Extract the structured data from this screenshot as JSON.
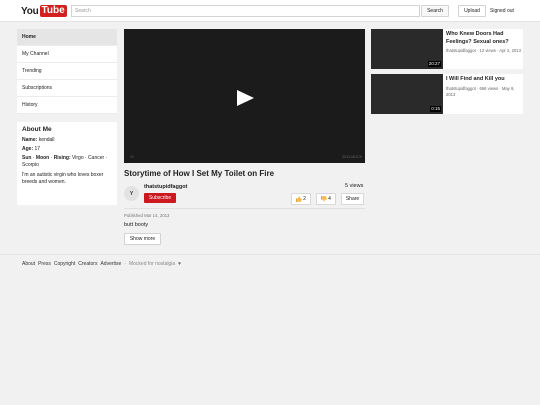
{
  "header": {
    "logo_you": "You",
    "logo_tube": "Tube",
    "search_placeholder": "Search",
    "search_button": "Search",
    "upload_button": "Upload",
    "signout_link": "Signed out"
  },
  "sidebar": {
    "items": [
      {
        "label": "Home"
      },
      {
        "label": "My Channel"
      },
      {
        "label": "Trending"
      },
      {
        "label": "Subscriptions"
      },
      {
        "label": "History"
      }
    ]
  },
  "about": {
    "heading": "About Me",
    "name_label": "Name:",
    "name_value": "kendall",
    "age_label": "Age:",
    "age_value": "17",
    "sun_label": "Sun",
    "sep1": "·",
    "moon_label": "Moon",
    "sep2": "·",
    "rising_label": "Rising:",
    "signs": "Virgo · Cancer · Scorpio",
    "bio": "I'm an autistic virgin who loves boxer breeds and women."
  },
  "player": {
    "corner_left": "00",
    "corner_right": "2013 MOCK"
  },
  "video": {
    "title": "Storytime of How I Set My Toilet on Fire",
    "channel": "thatstupidfaggot",
    "avatar_letter": "Y",
    "subscribe_label": "Subscribe",
    "views": "5 views",
    "likes": "2",
    "dislikes": "4",
    "share_label": "Share",
    "published": "Published Mar 14, 2013",
    "description": "butt booty",
    "show_more": "Show more"
  },
  "related": [
    {
      "title": "Who Knew Doors Had Feelings? Sexual ones?",
      "meta": "thatstupidfaggot · 12 views · Apr 2, 2013",
      "duration": "20:27"
    },
    {
      "title": "I Will Find and Kill you",
      "meta": "thatstupidfaggot · 666 views · May 9, 2013",
      "duration": "0:15"
    }
  ],
  "footer": {
    "links": [
      "About",
      "Press",
      "Copyright",
      "Creators",
      "Advertise"
    ],
    "separator": "·",
    "mocked": "Mocked for nostalgia",
    "heart": "♥"
  },
  "icons": {
    "play": "play-icon",
    "thumbs_up": "thumbs-up-icon",
    "thumbs_down": "thumbs-down-icon"
  },
  "colors": {
    "brand_red": "#d21f1f",
    "subscribe_red": "#cc181e",
    "player_bg": "#1b1b1b",
    "page_bg": "#f1f1f1"
  }
}
